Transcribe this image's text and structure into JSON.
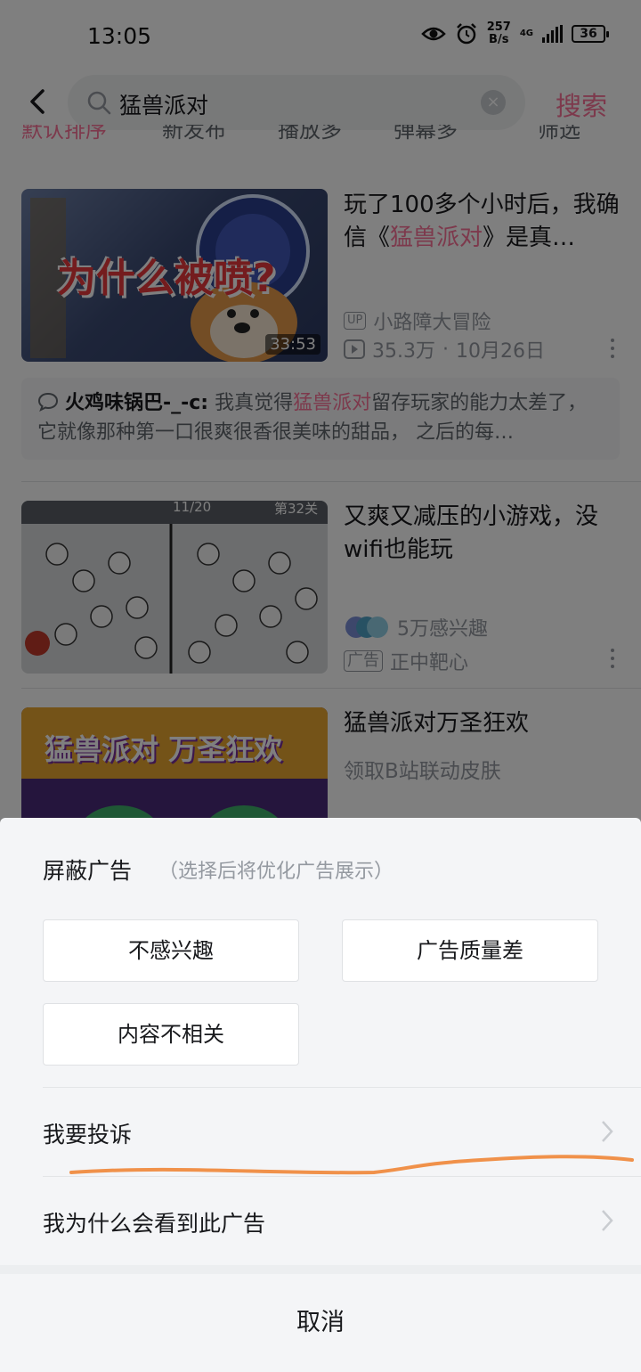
{
  "status_bar": {
    "time": "13:05",
    "speed_value": "257",
    "speed_unit": "B/s",
    "network": "4G",
    "battery": "36"
  },
  "search": {
    "query": "猛兽派对",
    "button": "搜索"
  },
  "sort_tabs": [
    "默认排序",
    "新发布",
    "播放多",
    "弹幕多",
    "筛选"
  ],
  "results": [
    {
      "title_prefix": "玩了100多个小时后，我确信《",
      "title_highlight": "猛兽派对",
      "title_suffix": "》是真…",
      "thumb_text": "为什么被喷?",
      "duration": "33:53",
      "up_badge": "UP",
      "author": "小路障大冒险",
      "views": "35.3万",
      "date": "10月26日",
      "comment_user": "火鸡味锅巴-_-c:",
      "comment_pre": "我真觉得",
      "comment_highlight": "猛兽派对",
      "comment_post": "留存玩家的能力太差了，它就像那种第一口很爽很香很美味的甜品， 之后的每…"
    },
    {
      "title": "又爽又减压的小游戏，没wifi也能玩",
      "thumb_hud_1": "11/20",
      "thumb_hud_2": "第32关",
      "interest": "5万感兴趣",
      "ad_badge": "广告",
      "advertiser": "正中靶心"
    },
    {
      "title": "猛兽派对万圣狂欢",
      "subtitle": "领取B站联动皮肤",
      "thumb_text": "猛兽派对 万圣狂欢"
    }
  ],
  "sheet": {
    "title": "屏蔽广告",
    "subtitle": "（选择后将优化广告展示）",
    "options": [
      "不感兴趣",
      "广告质量差",
      "内容不相关"
    ],
    "rows": [
      "我要投诉",
      "我为什么会看到此广告"
    ],
    "cancel": "取消"
  },
  "colors": {
    "accent": "#fb7299",
    "annotation": "#f0914a"
  }
}
